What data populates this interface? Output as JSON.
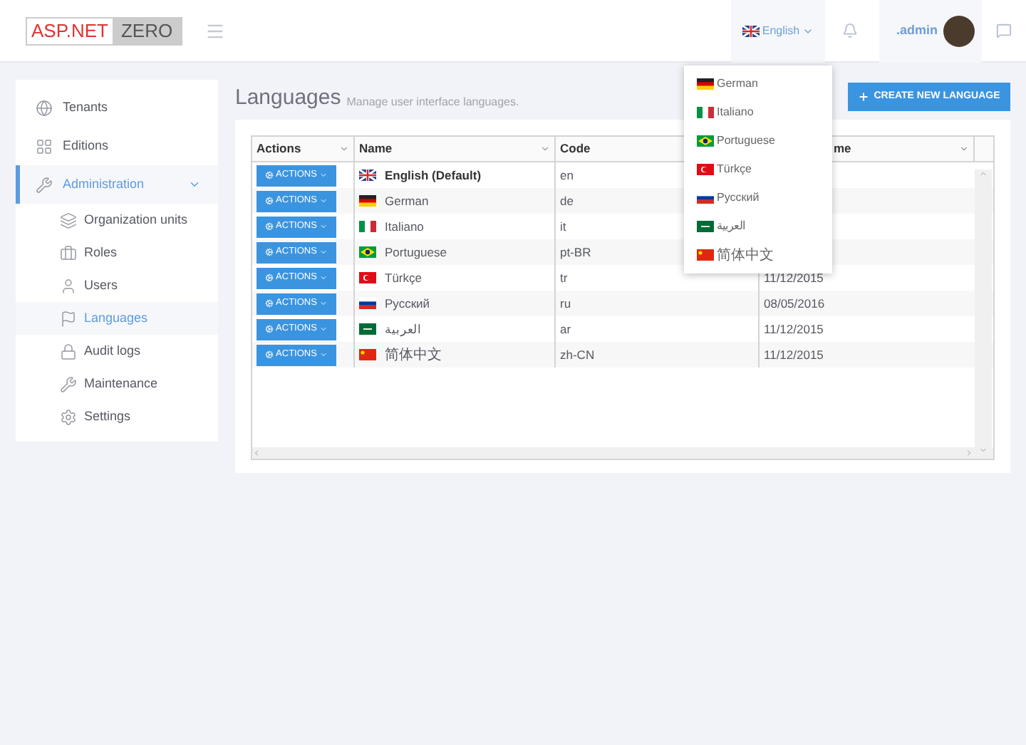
{
  "header": {
    "logo_left": "ASP.NET",
    "logo_right": "ZERO",
    "language": {
      "label": "English",
      "kind": "gb"
    },
    "user": ".admin"
  },
  "sidebar": {
    "items": [
      {
        "label": "Tenants",
        "kind": "globe",
        "selected": false
      },
      {
        "label": "Editions",
        "kind": "grid",
        "selected": false
      },
      {
        "label": "Administration",
        "kind": "wrench",
        "selected": true,
        "expanded": true,
        "children": [
          {
            "label": "Organization units",
            "kind": "layers",
            "selected": false
          },
          {
            "label": "Roles",
            "kind": "briefcase",
            "selected": false
          },
          {
            "label": "Users",
            "kind": "user",
            "selected": false
          },
          {
            "label": "Languages",
            "kind": "flag",
            "selected": true
          },
          {
            "label": "Audit logs",
            "kind": "lock",
            "selected": false
          },
          {
            "label": "Maintenance",
            "kind": "wrench",
            "selected": false
          },
          {
            "label": "Settings",
            "kind": "gear",
            "selected": false
          }
        ]
      }
    ]
  },
  "page": {
    "title": "Languages",
    "subtitle": "Manage user interface languages.",
    "create_button": "CREATE NEW LANGUAGE"
  },
  "table": {
    "columns": [
      "Actions",
      "Name",
      "Code",
      "me"
    ],
    "rows": [
      {
        "action": "ACTIONS",
        "kind": "gb",
        "name": "English (Default)",
        "default": true,
        "code": "en"
      },
      {
        "action": "ACTIONS",
        "kind": "de",
        "name": "German",
        "default": false,
        "code": "de"
      },
      {
        "action": "ACTIONS",
        "kind": "it",
        "name": "Italiano",
        "default": false,
        "code": "it"
      },
      {
        "action": "ACTIONS",
        "kind": "br",
        "name": "Portuguese",
        "default": false,
        "code": "pt-BR"
      },
      {
        "action": "ACTIONS",
        "kind": "tr",
        "name": "Türkçe",
        "default": false,
        "code": "tr",
        "column_4": "11/12/2015"
      },
      {
        "action": "ACTIONS",
        "kind": "ru",
        "name": "Русский",
        "default": false,
        "code": "ru",
        "column_4": "08/05/2016"
      },
      {
        "action": "ACTIONS",
        "kind": "sa",
        "name": "العربية",
        "default": false,
        "code": "ar",
        "column_4": "11/12/2015"
      },
      {
        "action": "ACTIONS",
        "kind": "cn",
        "name": "简体中文",
        "default": false,
        "code": "zh-CN",
        "column_4": "11/12/2015"
      }
    ]
  },
  "language_menu": {
    "items": [
      {
        "label": "German",
        "kind": "de"
      },
      {
        "label": "Italiano",
        "kind": "it"
      },
      {
        "label": "Portuguese",
        "kind": "br"
      },
      {
        "label": "Türkçe",
        "kind": "tr"
      },
      {
        "label": "Русский",
        "kind": "ru"
      },
      {
        "label": "العربية",
        "kind": "sa"
      },
      {
        "label": "简体中文",
        "kind": "cn"
      }
    ]
  }
}
